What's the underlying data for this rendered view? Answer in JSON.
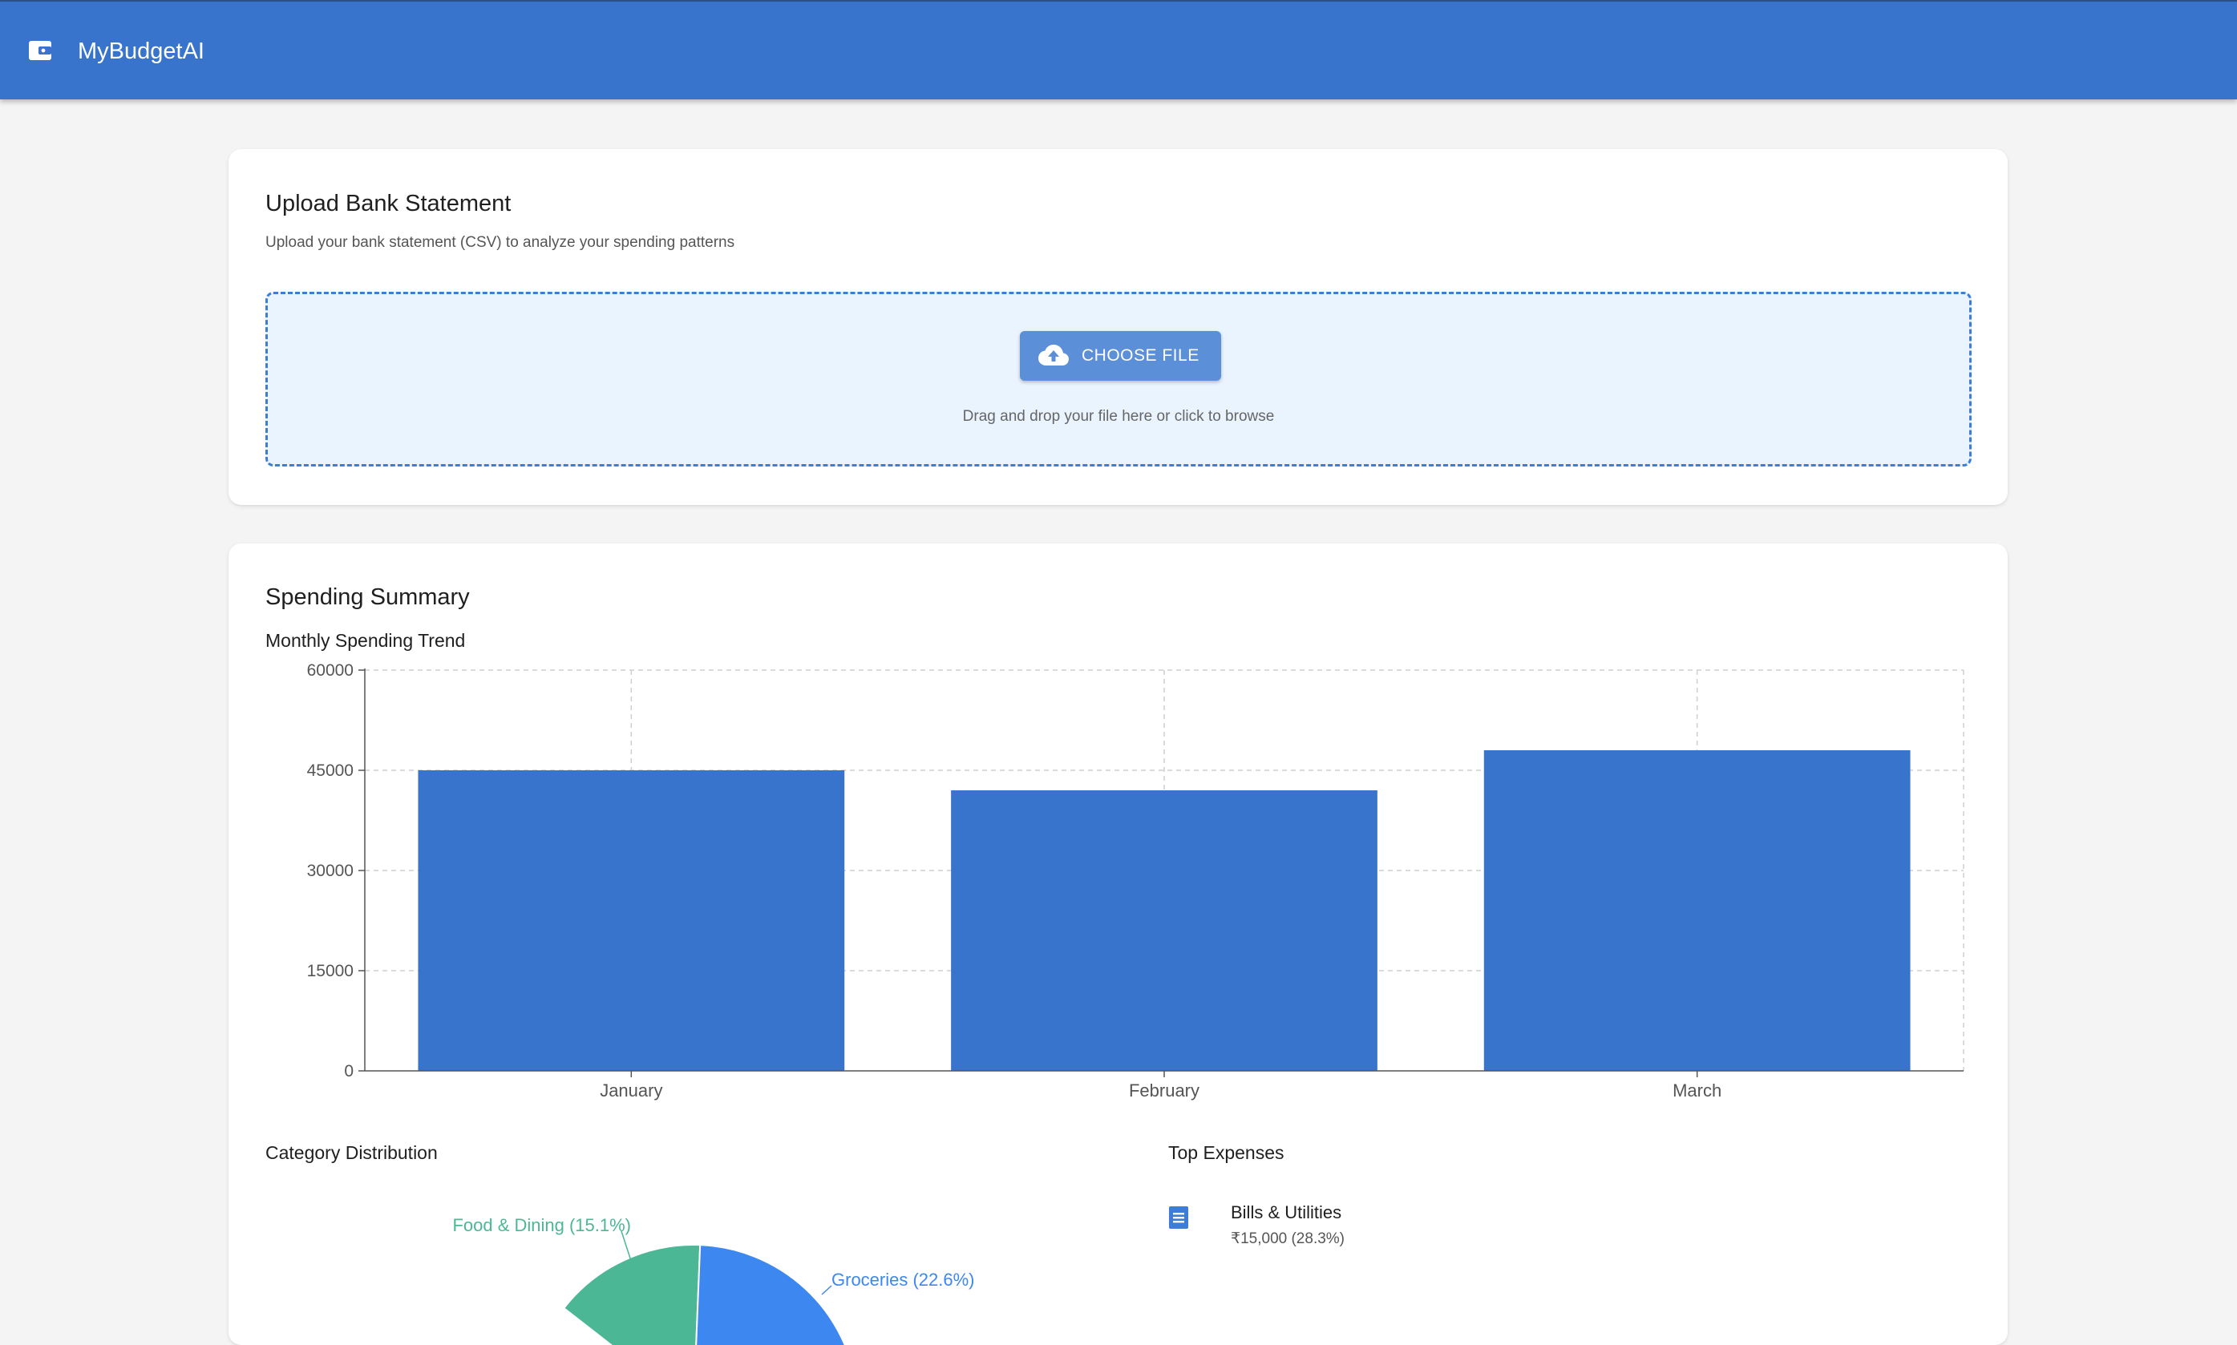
{
  "app": {
    "title": "MyBudgetAI",
    "logo_icon": "wallet-icon",
    "accent": "#3874cb"
  },
  "upload": {
    "title": "Upload Bank Statement",
    "subtitle": "Upload your bank statement (CSV) to analyze your spending patterns",
    "button_label": "CHOOSE FILE",
    "button_icon": "cloud-upload-icon",
    "hint": "Drag and drop your file here or click to browse"
  },
  "summary": {
    "title": "Spending Summary",
    "monthly_title": "Monthly Spending Trend",
    "category_title": "Category Distribution",
    "top_expenses_title": "Top Expenses"
  },
  "chart_data": [
    {
      "type": "bar",
      "title": "Monthly Spending Trend",
      "categories": [
        "January",
        "February",
        "March"
      ],
      "values": [
        45000,
        42000,
        48000
      ],
      "ylim": [
        0,
        60000
      ],
      "yticks": [
        "0",
        "15000",
        "30000",
        "45000",
        "60000"
      ],
      "grid": true,
      "color": "#3874cb"
    },
    {
      "type": "pie",
      "title": "Category Distribution",
      "labels": [
        "Food & Dining (15.1%)",
        "Groceries (22.6%)"
      ],
      "values": [
        15.1,
        22.6
      ],
      "colors": [
        "#4bb795",
        "#3d87f0"
      ]
    }
  ],
  "top_expenses": [
    {
      "name": "Bills & Utilities",
      "amount": "₹15,000 (28.3%)",
      "icon": "receipt-icon"
    }
  ]
}
